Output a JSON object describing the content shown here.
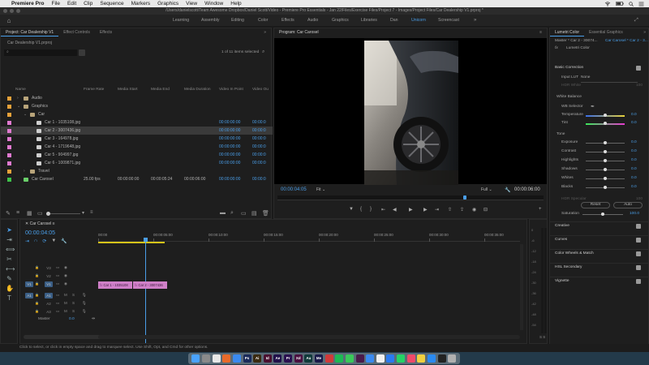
{
  "menubar": {
    "items": [
      "Premiere Pro",
      "File",
      "Edit",
      "Clip",
      "Sequence",
      "Markers",
      "Graphics",
      "View",
      "Window",
      "Help"
    ],
    "status_time": "",
    "icons": [
      "apple-icon",
      "wifi-icon",
      "battery-icon",
      "search-icon",
      "menu-extras-icon"
    ]
  },
  "titlebar": {
    "path": "/Users/danielscott/Team Awesome Dropbox/Daniel Scott/Video - Premiere Pro Essentials - Jan 22/Files/Exercise Files/Project 7 - Images/Project Files/Car Dealership V1.prproj *"
  },
  "workspaces": {
    "items": [
      "Learning",
      "Assembly",
      "Editing",
      "Color",
      "Effects",
      "Audio",
      "Graphics",
      "Libraries",
      "Dan",
      "Unicorn",
      "Screencast"
    ],
    "active": "Unicorn"
  },
  "project": {
    "tabs": [
      "Project: Car Dealership V1",
      "Effect Controls",
      "Effects"
    ],
    "file": "Car Dealership V1.prproj",
    "selection_count": "1 of 11 items selected",
    "columns": [
      "Name",
      "Frame Rate",
      "Media Start",
      "Media End",
      "Media Duration",
      "Video In Point",
      "Video Ou"
    ],
    "rows": [
      {
        "name": "Audio",
        "type": "bin",
        "color": "#e8a23a",
        "indent": 0,
        "expanded": false
      },
      {
        "name": "Graphics",
        "type": "bin",
        "color": "#e8a23a",
        "indent": 0,
        "expanded": true
      },
      {
        "name": "Car",
        "type": "bin",
        "color": "#e8a23a",
        "indent": 1,
        "expanded": true
      },
      {
        "name": "Car 1 - 1035108.jpg",
        "type": "image",
        "color": "#e07ad0",
        "indent": 2,
        "vin": "00:00:00:00",
        "vout": "00:00:0"
      },
      {
        "name": "Car 2 - 3007436.jpg",
        "type": "image",
        "color": "#e07ad0",
        "indent": 2,
        "vin": "00:00:00:00",
        "vout": "00:00:0",
        "selected": true
      },
      {
        "name": "Car 3 - 164978.jpg",
        "type": "image",
        "color": "#e07ad0",
        "indent": 2,
        "vin": "00:00:00:00",
        "vout": "00:00:0"
      },
      {
        "name": "Car 4 - 1719648.jpg",
        "type": "image",
        "color": "#e07ad0",
        "indent": 2,
        "vin": "00:00:00:00",
        "vout": "00:00:0"
      },
      {
        "name": "Car 5 - 904997.jpg",
        "type": "image",
        "color": "#e07ad0",
        "indent": 2,
        "vin": "00:00:00:00",
        "vout": "00:00:0"
      },
      {
        "name": "Car 6 - 1009871.jpg",
        "type": "image",
        "color": "#e07ad0",
        "indent": 2,
        "vin": "00:00:00:00",
        "vout": "00:00:0"
      },
      {
        "name": "Travel",
        "type": "bin",
        "color": "#e8a23a",
        "indent": 1,
        "expanded": false
      },
      {
        "name": "Car Carosel",
        "type": "sequence",
        "color": "#3ec24a",
        "indent": 0,
        "fps": "25.00 fps",
        "mstart": "00:00:00:00",
        "mend": "00:00:05:24",
        "mdur": "00:00:06:00",
        "vin": "00:00:00:00",
        "vout": "00:00:0"
      }
    ]
  },
  "program": {
    "tab": "Program: Car Carosel",
    "timecode": "00:00:04:05",
    "fit": "Fit",
    "quality": "Full",
    "duration": "00:00:06:00"
  },
  "lumetri": {
    "tabs": [
      "Lumetri Color",
      "Essential Graphics"
    ],
    "master": "Master * Car 2 - 30074...",
    "clip": "Car Carosel * Car 2 - 3...",
    "fx": "fx",
    "effect": "Lumetri Color",
    "basic_correction": "Basic Correction",
    "input_lut": "Input LUT",
    "input_lut_value": "None",
    "hdr_white": "HDR White",
    "hdr_white_value": "100",
    "white_balance": "White Balance",
    "wb_selector": "WB Selector",
    "tone": "Tone",
    "sliders": [
      {
        "label": "Temperature",
        "value": "0.0",
        "pos": 0.5
      },
      {
        "label": "Tint",
        "value": "0.0",
        "pos": 0.5
      },
      {
        "label": "Exposure",
        "value": "0.0",
        "pos": 0.5
      },
      {
        "label": "Contrast",
        "value": "0.0",
        "pos": 0.5
      },
      {
        "label": "Highlights",
        "value": "0.0",
        "pos": 0.5
      },
      {
        "label": "Shadows",
        "value": "0.0",
        "pos": 0.5
      },
      {
        "label": "Whites",
        "value": "0.0",
        "pos": 0.5
      },
      {
        "label": "Blacks",
        "value": "0.0",
        "pos": 0.5
      }
    ],
    "hdr_specular": "HDR Specular",
    "hdr_specular_value": "100",
    "reset": "Reset",
    "auto": "Auto",
    "saturation": "Saturation",
    "saturation_value": "100.0",
    "sections": [
      "Creative",
      "Curves",
      "Color Wheels & Match",
      "HSL Secondary",
      "Vignette"
    ]
  },
  "timeline": {
    "tab": "Car Carosel",
    "timecode": "00:00:04:05",
    "ruler": [
      "00:00",
      "00:00:05:00",
      "00:00:10:00",
      "00:00:15:00",
      "00:00:20:00",
      "00:00:25:00",
      "00:00:30:00",
      "00:00:35:00"
    ],
    "video_tracks": [
      "V3",
      "V2",
      "V1"
    ],
    "audio_tracks": [
      "A1",
      "A2",
      "A3"
    ],
    "source_v": "V1",
    "source_a": "A1",
    "master": "Master",
    "master_value": "0.0",
    "clips": [
      {
        "label": "Car 1 - 1035108",
        "track": "V1"
      },
      {
        "label": "Car 2 - 3007436",
        "track": "V1"
      }
    ]
  },
  "meter": {
    "labels": [
      "0",
      "-6",
      "-12",
      "-18",
      "-24",
      "-30",
      "-36",
      "-42",
      "-48",
      "-54"
    ],
    "solo": "S S"
  },
  "status": {
    "text": "Click to select, or click in empty space and drag to marquee select. Use Shift, Opt, and Cmd for other options."
  },
  "dock": {
    "apps": [
      {
        "name": "finder",
        "color": "#4aa3ff",
        "label": ""
      },
      {
        "name": "launchpad",
        "color": "#8a8a8a",
        "label": ""
      },
      {
        "name": "chrome",
        "color": "#e8e8e8",
        "label": ""
      },
      {
        "name": "firefox",
        "color": "#e86a2a",
        "label": ""
      },
      {
        "name": "safari",
        "color": "#3a8af0",
        "label": ""
      },
      {
        "name": "photoshop",
        "color": "#1a2a5a",
        "label": "Ps"
      },
      {
        "name": "illustrator",
        "color": "#3a2a10",
        "label": "Ai"
      },
      {
        "name": "indesign",
        "color": "#4a1030",
        "label": "Id"
      },
      {
        "name": "after-effects",
        "color": "#20104a",
        "label": "Ae"
      },
      {
        "name": "premiere",
        "color": "#2a1050",
        "label": "Pr"
      },
      {
        "name": "xd",
        "color": "#4a1040",
        "label": "Xd"
      },
      {
        "name": "audition",
        "color": "#103a3a",
        "label": "Au"
      },
      {
        "name": "media-encoder",
        "color": "#1a1a4a",
        "label": "Me"
      },
      {
        "name": "creative-cloud",
        "color": "#d03a3a",
        "label": ""
      },
      {
        "name": "spotify",
        "color": "#1db954",
        "label": ""
      },
      {
        "name": "messages",
        "color": "#3ac85a",
        "label": ""
      },
      {
        "name": "slack",
        "color": "#4a1a4a",
        "label": ""
      },
      {
        "name": "mail",
        "color": "#3a8af0",
        "label": ""
      },
      {
        "name": "calendar",
        "color": "#f0f0f0",
        "label": ""
      },
      {
        "name": "zoom",
        "color": "#2a7af0",
        "label": ""
      },
      {
        "name": "whatsapp",
        "color": "#25d366",
        "label": ""
      },
      {
        "name": "music",
        "color": "#f04a6a",
        "label": ""
      },
      {
        "name": "notes",
        "color": "#f0d040",
        "label": ""
      },
      {
        "name": "app-store",
        "color": "#2a8af0",
        "label": ""
      },
      {
        "name": "terminal",
        "color": "#222",
        "label": ""
      },
      {
        "name": "trash",
        "color": "#b0b0b0",
        "label": ""
      }
    ]
  }
}
